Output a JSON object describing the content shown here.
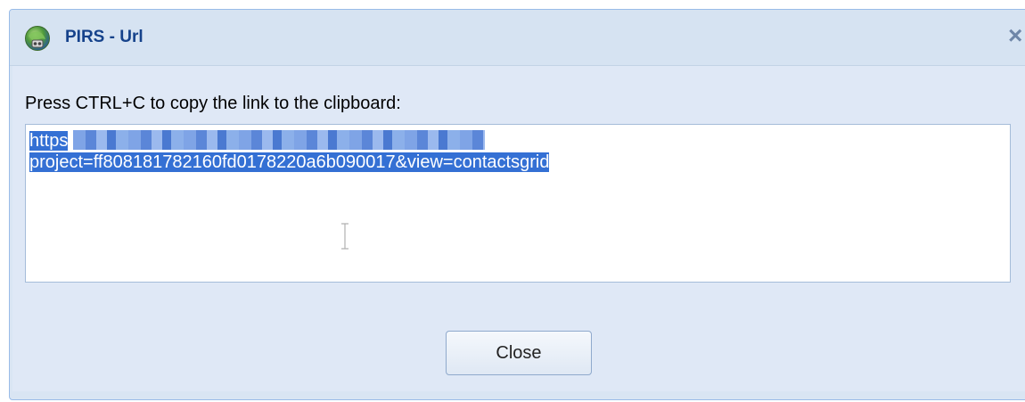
{
  "window": {
    "title": "PIRS - Url",
    "close_glyph": "×",
    "app_icon": "pirs-globe-icon"
  },
  "dialog": {
    "prompt": "Press CTRL+C to copy the link to the clipboard:",
    "url_line1_visible": "https",
    "url_line2": "project=ff808181782160fd0178220a6b090017&view=contactsgrid",
    "url_selected": true,
    "url_redacted": true,
    "close_button_label": "Close"
  },
  "colors": {
    "title_text": "#15428b",
    "selection": "#3470d4",
    "panel_bg": "#dfe8f6"
  }
}
